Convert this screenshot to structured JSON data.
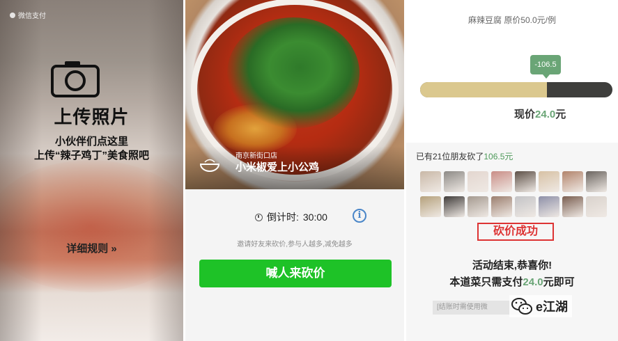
{
  "panel1": {
    "app_label": "微信支付",
    "upload_title": "上传照片",
    "subtitle_line1": "小伙伴们点这里",
    "subtitle_line2": "上传“辣子鸡丁”美食照吧",
    "rules_link": "详细规则 »"
  },
  "panel2": {
    "caption_small": "南京新街口店",
    "caption_big": "小米椒爱上小公鸡",
    "countdown_label": "倒计时:",
    "countdown_value": "30:00",
    "info_icon_glyph": "i",
    "hint": "邀请好友来砍价,参与人越多,减免越多",
    "button_label": "喊人来砍价"
  },
  "panel3": {
    "dish_line": "麻辣豆腐  原价50.0元/例",
    "tooltip": "-106.5",
    "progress_fraction": 0.66,
    "price_label": "现价",
    "price_value": "24.0",
    "price_unit": "元",
    "friends_prefix": "已有21位朋友砍了",
    "friends_amount": "106.5元",
    "stamp": "砍价成功",
    "end_line1": "活动结束,恭喜你!",
    "end_line2_prefix": "本道菜只需支付",
    "end_line2_value": "24.0",
    "end_line2_suffix": "元即可",
    "note": "[结账时需使用微",
    "brand": "e江湖",
    "avatar_colors": [
      "#c9b8a7",
      "#8d8a86",
      "#e3d6cf",
      "#c98d86",
      "#5e5148",
      "#d7c1a4",
      "#b2846c",
      "#6b6560",
      "#b5a17c",
      "#403c3a",
      "#a59a90",
      "#9c7f6f",
      "#c3c3c6",
      "#8e90a8",
      "#7a5e50",
      "#d9d2cc"
    ]
  },
  "colors": {
    "wechat_green": "#1ec227",
    "accent_green": "#6aa576",
    "stamp_red": "#d33333",
    "bar_gold": "#dbc88e",
    "bar_dark": "#3e3e3c"
  }
}
